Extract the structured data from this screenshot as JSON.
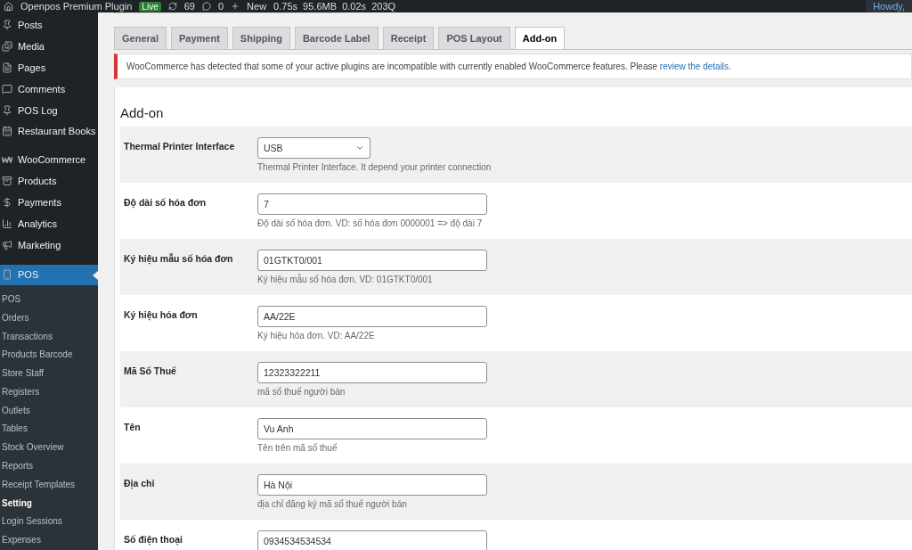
{
  "admin_bar": {
    "site": "Openpos Premium Plugin",
    "badge": "Live",
    "updates": "69",
    "comments": "0",
    "new": "New",
    "stats": "0.75s  95.6MB  0.02s  203Q",
    "greeting": "Howdy,"
  },
  "sidebar": {
    "items": [
      {
        "label": "Posts",
        "selected": false
      },
      {
        "label": "Media",
        "selected": false
      },
      {
        "label": "Pages",
        "selected": false
      },
      {
        "label": "Comments",
        "selected": false
      },
      {
        "label": "POS Log",
        "selected": false
      },
      {
        "label": "Restaurant Books",
        "selected": false
      },
      {
        "label": "WooCommerce",
        "selected": false
      },
      {
        "label": "Products",
        "selected": false
      },
      {
        "label": "Payments",
        "selected": false
      },
      {
        "label": "Analytics",
        "selected": false
      },
      {
        "label": "Marketing",
        "selected": false
      },
      {
        "label": "POS",
        "selected": true
      }
    ],
    "submenu": [
      {
        "label": "POS",
        "selected": false
      },
      {
        "label": "Orders",
        "selected": false
      },
      {
        "label": "Transactions",
        "selected": false
      },
      {
        "label": "Products Barcode",
        "selected": false
      },
      {
        "label": "Store Staff",
        "selected": false
      },
      {
        "label": "Registers",
        "selected": false
      },
      {
        "label": "Outlets",
        "selected": false
      },
      {
        "label": "Tables",
        "selected": false
      },
      {
        "label": "Stock Overview",
        "selected": false
      },
      {
        "label": "Reports",
        "selected": false
      },
      {
        "label": "Receipt Templates",
        "selected": false
      },
      {
        "label": "Setting",
        "selected": true
      },
      {
        "label": "Login Sessions",
        "selected": false
      },
      {
        "label": "Expenses",
        "selected": false
      }
    ]
  },
  "tabs": [
    {
      "label": "General",
      "selected": false
    },
    {
      "label": "Payment",
      "selected": false
    },
    {
      "label": "Shipping",
      "selected": false
    },
    {
      "label": "Barcode Label",
      "selected": false
    },
    {
      "label": "Receipt",
      "selected": false
    },
    {
      "label": "POS Layout",
      "selected": false
    },
    {
      "label": "Add-on",
      "selected": true
    }
  ],
  "notice": {
    "text": "WooCommerce has detected that some of your active plugins are incompatible with currently enabled WooCommerce features. Please ",
    "link": "review the details",
    "after": "."
  },
  "form": {
    "title": "Add-on",
    "rows": [
      {
        "kind": "select",
        "label": "Thermal Printer Interface",
        "value": "USB",
        "description": "Thermal Printer Interface. It depend your printer connection"
      },
      {
        "kind": "text",
        "label": "Độ dài số hóa đơn",
        "value": "7",
        "description": "Độ dài số hóa đơn. VD: số hóa đơn 0000001 => độ dài 7"
      },
      {
        "kind": "text",
        "label": "Ký hiệu mẫu số hóa đơn",
        "value": "01GTKT0/001",
        "description": "Ký hiệu mẫu số hóa đơn. VD: 01GTKT0/001"
      },
      {
        "kind": "text",
        "label": "Ký hiệu hóa đơn",
        "value": "AA/22E",
        "description": "Ký hiệu hóa đơn. VD: AA/22E"
      },
      {
        "kind": "text",
        "label": "Mã Số Thuế",
        "value": "12323322211",
        "description": "mã số thuế người bán"
      },
      {
        "kind": "text",
        "label": "Tên",
        "value": "Vu Anh",
        "description": "Tên trên mã số thuế"
      },
      {
        "kind": "text",
        "label": "Địa chỉ",
        "value": "Hà Nội",
        "description": "địa chỉ đăng ký mã số thuế người bán"
      },
      {
        "kind": "text",
        "label": "Số điện thoại",
        "value": "0934534534534"
      }
    ]
  }
}
